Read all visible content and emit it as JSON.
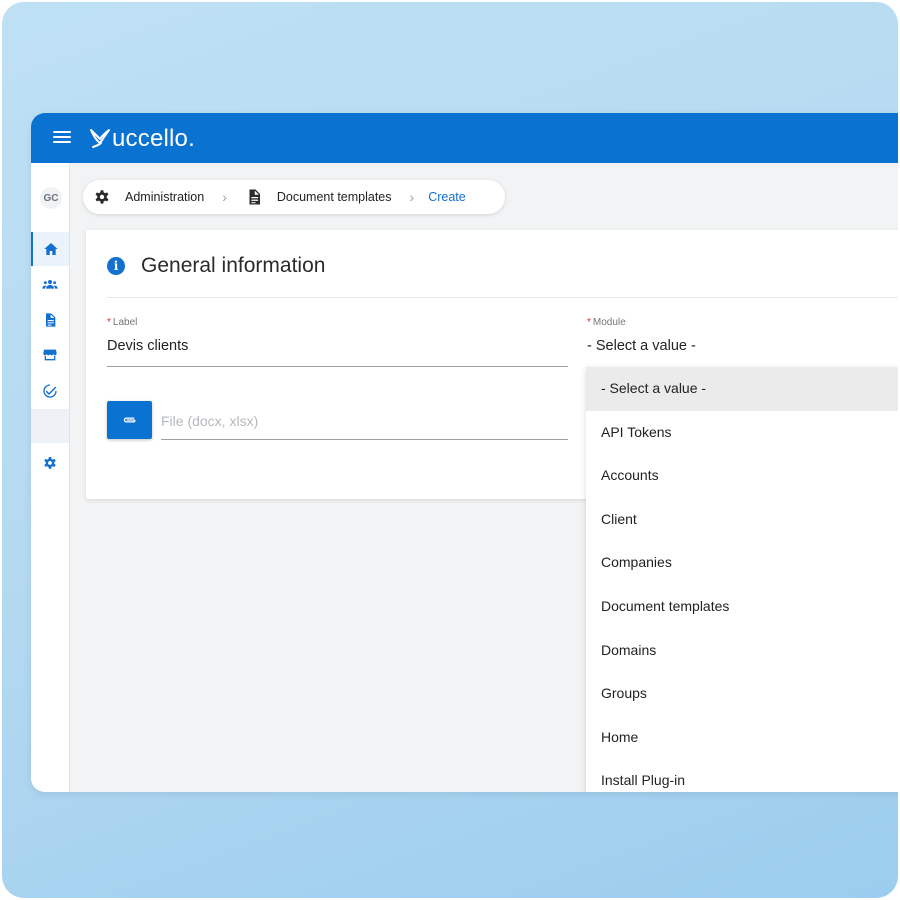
{
  "app": {
    "logo_text": "uccello.",
    "menu_icon": "hamburger-icon"
  },
  "sidebar": {
    "avatar": "GC",
    "items": [
      {
        "name": "home",
        "icon": "home-icon"
      },
      {
        "name": "users",
        "icon": "users-group-icon"
      },
      {
        "name": "documents",
        "icon": "document-icon"
      },
      {
        "name": "store",
        "icon": "store-icon"
      },
      {
        "name": "tasks",
        "icon": "check-circle-icon"
      },
      {
        "name": "settings",
        "icon": "gear-icon"
      }
    ]
  },
  "breadcrumb": {
    "items": [
      {
        "label": "Administration",
        "icon": "gear-icon"
      },
      {
        "label": "Document templates",
        "icon": "document-icon"
      },
      {
        "label": "Create"
      }
    ]
  },
  "form": {
    "title": "General information",
    "label_field": {
      "label": "Label",
      "value": "Devis clients"
    },
    "module_field": {
      "label": "Module",
      "value": "- Select a value -"
    },
    "file_field": {
      "placeholder": "File (docx, xlsx)",
      "icon": "paperclip-icon"
    }
  },
  "module_dropdown": {
    "options": [
      "- Select a value -",
      "API Tokens",
      "Accounts",
      "Client",
      "Companies",
      "Document templates",
      "Domains",
      "Groups",
      "Home",
      "Install Plug-in"
    ],
    "selected_index": 0
  },
  "colors": {
    "primary": "#0a72d1",
    "required": "#e0282e"
  }
}
